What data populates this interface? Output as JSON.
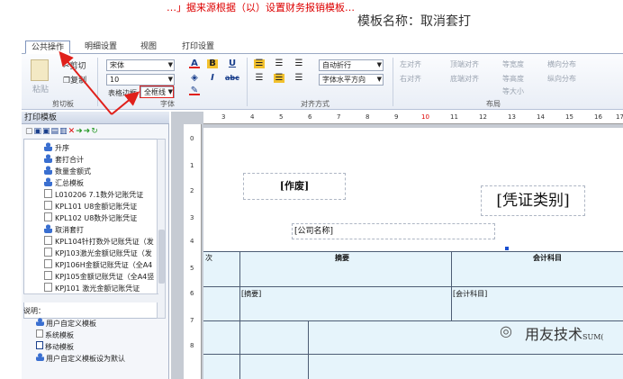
{
  "header": {
    "red_banner": "…」据来源根据（以）设置财务报销模板…",
    "template_label": "模板名称：",
    "template_name": "取消套打"
  },
  "tabs": [
    {
      "label": "公共操作",
      "active": true
    },
    {
      "label": "明细设置",
      "active": false
    },
    {
      "label": "视图",
      "active": false
    },
    {
      "label": "打印设置",
      "active": false
    }
  ],
  "ribbon": {
    "clipboard": {
      "paste": "粘贴",
      "cut": "剪切",
      "copy": "复制",
      "group": "剪切板"
    },
    "font": {
      "family": "宋体",
      "size": "10",
      "border_label": "表格边框",
      "border_value": "全框线",
      "group": "字体",
      "colors": {
        "text": "#e0201b",
        "highlight": "#f2c12e",
        "fill": "#f2c12e"
      }
    },
    "alignment": {
      "wrap": "自动折行",
      "direction": "字体水平方向",
      "group": "对齐方式"
    },
    "layout": {
      "items": [
        "左对齐",
        "顶端对齐",
        "等宽度",
        "横向分布",
        "右对齐",
        "底端对齐",
        "等高度",
        "纵向分布",
        "等大小"
      ],
      "group": "布局"
    }
  },
  "left_panel": {
    "title": "打印模板",
    "tree_items": [
      {
        "label": "升序",
        "icon": "user-icon"
      },
      {
        "label": "套打合计",
        "icon": "user-icon"
      },
      {
        "label": "数量金额式",
        "icon": "user-icon"
      },
      {
        "label": "汇总模板",
        "icon": "user-icon"
      },
      {
        "label": "L010206 7.1数外记账凭证",
        "icon": "doc-icon"
      },
      {
        "label": "KPL101 U8金额记账凭证",
        "icon": "doc-icon"
      },
      {
        "label": "KPL102 U8数外记账凭证",
        "icon": "doc-icon"
      },
      {
        "label": "取消套打",
        "icon": "user-icon"
      },
      {
        "label": "KPL104针打数外记账凭证（发",
        "icon": "doc-icon"
      },
      {
        "label": "KPJ103激光金额记账凭证（发",
        "icon": "doc-icon"
      },
      {
        "label": "KPJ106H金额记账凭证（全A4",
        "icon": "doc-icon"
      },
      {
        "label": "KPJ105金额记账凭证（全A4竖",
        "icon": "doc-icon"
      },
      {
        "label": "KPJ101 激光金额记账凭证",
        "icon": "doc-icon"
      }
    ],
    "legend_title": "说明：",
    "legend": [
      {
        "label": "用户自定义模板",
        "icon": "user-icon"
      },
      {
        "label": "系统模板",
        "icon": "doc-icon"
      },
      {
        "label": "移动模板",
        "icon": "doc-icon"
      },
      {
        "label": "用户自定义模板设为默认",
        "icon": "user-icon"
      }
    ]
  },
  "ruler": {
    "top": [
      "3",
      "4",
      "5",
      "6",
      "7",
      "8",
      "9",
      "10",
      "11",
      "12",
      "13",
      "14",
      "15",
      "16",
      "17"
    ],
    "left": [
      "0",
      "1",
      "2",
      "3",
      "4",
      "5",
      "6",
      "7",
      "8"
    ]
  },
  "canvas": {
    "zuofei": "[作废]",
    "voucher_type": "[凭证类别]",
    "company": "[公司名称]",
    "col_ci": "次",
    "col_zhaiyao": "摘要",
    "col_kemu": "会计科目",
    "cell_zhaiyao": "[摘要]",
    "cell_kemu": "[会计科目]"
  },
  "watermark": {
    "text": "用友技术",
    "suffix": "SUM("
  }
}
